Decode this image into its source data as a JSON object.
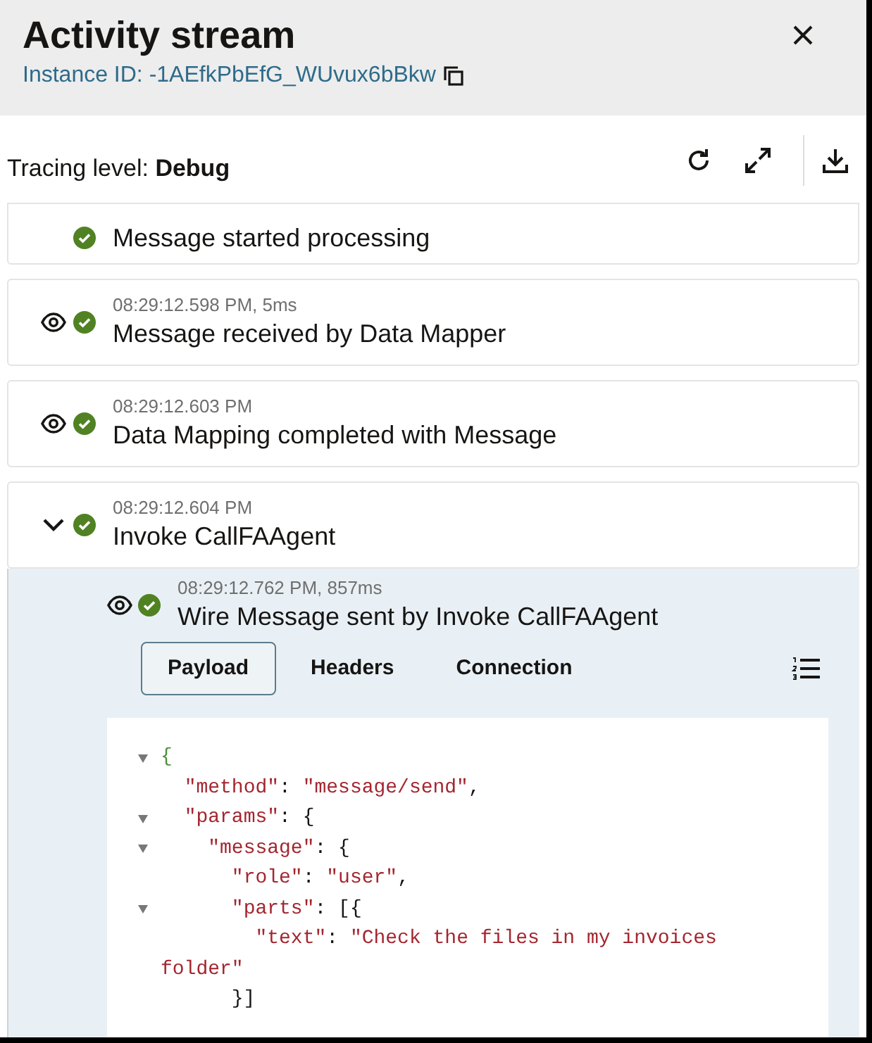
{
  "header": {
    "title": "Activity stream",
    "instance_id": "Instance ID: -1AEfkPbEfG_WUvux6bBkw"
  },
  "tracing": {
    "label": "Tracing level:",
    "value": "Debug"
  },
  "events": [
    {
      "kind": "plain",
      "title": "Message started processing"
    },
    {
      "kind": "viewable",
      "time": "08:29:12.598 PM, 5ms",
      "title": "Message received by Data Mapper"
    },
    {
      "kind": "viewable",
      "time": "08:29:12.603 PM",
      "title": "Data Mapping completed with Message"
    },
    {
      "kind": "expanded",
      "time": "08:29:12.604 PM",
      "title": "Invoke CallFAAgent"
    }
  ],
  "child_event": {
    "time": "08:29:12.762 PM, 857ms",
    "title": "Wire Message sent by Invoke CallFAAgent"
  },
  "tabs": [
    {
      "label": "Payload",
      "selected": true
    },
    {
      "label": "Headers",
      "selected": false
    },
    {
      "label": "Connection",
      "selected": false
    }
  ],
  "code_lines": [
    {
      "fold": true,
      "text": "{"
    },
    {
      "fold": false,
      "text": "  \"method\": \"message/send\","
    },
    {
      "fold": true,
      "text": "  \"params\": {"
    },
    {
      "fold": true,
      "text": "    \"message\": {"
    },
    {
      "fold": false,
      "text": "      \"role\": \"user\","
    },
    {
      "fold": true,
      "text": "      \"parts\": [{"
    },
    {
      "fold": false,
      "text": "        \"text\": \"Check the files in my invoices"
    },
    {
      "fold": false,
      "text": "folder\""
    },
    {
      "fold": false,
      "text": "      }]"
    }
  ]
}
